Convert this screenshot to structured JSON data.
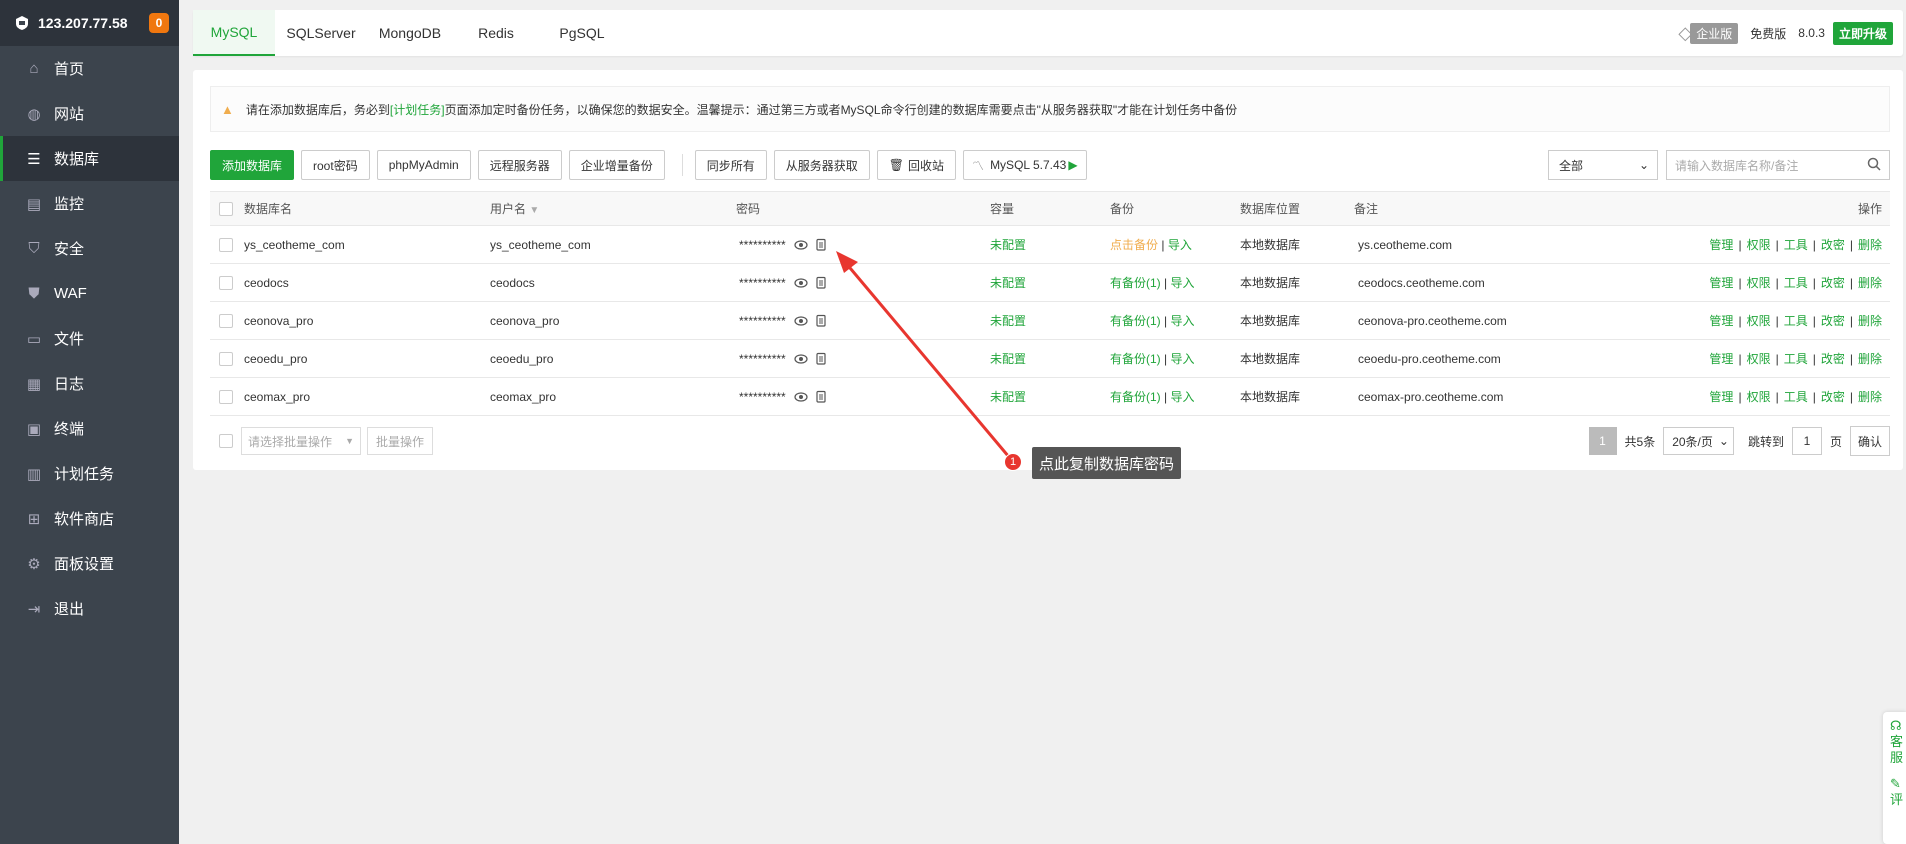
{
  "sidebar": {
    "ip": "123.207.77.58",
    "badge": "0",
    "items": [
      {
        "label": "首页",
        "icon": "home-icon"
      },
      {
        "label": "网站",
        "icon": "globe-icon"
      },
      {
        "label": "数据库",
        "icon": "database-icon"
      },
      {
        "label": "监控",
        "icon": "monitor-icon"
      },
      {
        "label": "安全",
        "icon": "shield-icon"
      },
      {
        "label": "WAF",
        "icon": "waf-shield-icon"
      },
      {
        "label": "文件",
        "icon": "folder-icon"
      },
      {
        "label": "日志",
        "icon": "log-icon"
      },
      {
        "label": "终端",
        "icon": "terminal-icon"
      },
      {
        "label": "计划任务",
        "icon": "calendar-icon"
      },
      {
        "label": "软件商店",
        "icon": "apps-icon"
      },
      {
        "label": "面板设置",
        "icon": "gear-icon"
      },
      {
        "label": "退出",
        "icon": "logout-icon"
      }
    ],
    "active_index": 2
  },
  "tabs": [
    "MySQL",
    "SQLServer",
    "MongoDB",
    "Redis",
    "PgSQL"
  ],
  "active_tab": 0,
  "top_right": {
    "enterprise": "企业版",
    "free": "免费版",
    "version": "8.0.3",
    "upgrade": "立即升级"
  },
  "alert": {
    "prefix": "请在添加数据库后，务必到",
    "link": "[计划任务]",
    "suffix": "页面添加定时备份任务，以确保您的数据安全。温馨提示：通过第三方或者MySQL命令行创建的数据库需要点击\"从服务器获取\"才能在计划任务中备份"
  },
  "toolbar": {
    "add_db": "添加数据库",
    "root_pw": "root密码",
    "phpmyadmin": "phpMyAdmin",
    "remote": "远程服务器",
    "incremental": "企业增量备份",
    "sync_all": "同步所有",
    "fetch": "从服务器获取",
    "recycle": "回收站",
    "mysql_version": "MySQL 5.7.43",
    "filter": "全部",
    "search_placeholder": "请输入数据库名称/备注"
  },
  "table": {
    "headers": {
      "name": "数据库名",
      "user": "用户名",
      "password": "密码",
      "capacity": "容量",
      "backup": "备份",
      "location": "数据库位置",
      "note": "备注",
      "ops": "操作"
    },
    "rows": [
      {
        "name": "ys_ceotheme_com",
        "user": "ys_ceotheme_com",
        "password": "**********",
        "capacity": "未配置",
        "backup": "点击备份",
        "backup_status": "none",
        "import": "导入",
        "location": "本地数据库",
        "note": "ys.ceotheme.com"
      },
      {
        "name": "ceodocs",
        "user": "ceodocs",
        "password": "**********",
        "capacity": "未配置",
        "backup": "有备份(1)",
        "backup_status": "has",
        "import": "导入",
        "location": "本地数据库",
        "note": "ceodocs.ceotheme.com"
      },
      {
        "name": "ceonova_pro",
        "user": "ceonova_pro",
        "password": "**********",
        "capacity": "未配置",
        "backup": "有备份(1)",
        "backup_status": "has",
        "import": "导入",
        "location": "本地数据库",
        "note": "ceonova-pro.ceotheme.com"
      },
      {
        "name": "ceoedu_pro",
        "user": "ceoedu_pro",
        "password": "**********",
        "capacity": "未配置",
        "backup": "有备份(1)",
        "backup_status": "has",
        "import": "导入",
        "location": "本地数据库",
        "note": "ceoedu-pro.ceotheme.com"
      },
      {
        "name": "ceomax_pro",
        "user": "ceomax_pro",
        "password": "**********",
        "capacity": "未配置",
        "backup": "有备份(1)",
        "backup_status": "has",
        "import": "导入",
        "location": "本地数据库",
        "note": "ceomax-pro.ceotheme.com"
      }
    ],
    "ops": [
      "管理",
      "权限",
      "工具",
      "改密",
      "删除"
    ]
  },
  "footer": {
    "batch_placeholder": "请选择批量操作",
    "batch_btn": "批量操作",
    "current_page": "1",
    "total": "共5条",
    "page_size": "20条/页",
    "jump_to": "跳转到",
    "jump_value": "1",
    "page_unit": "页",
    "confirm": "确认"
  },
  "annotation": {
    "number": "1",
    "text": "点此复制数据库密码"
  },
  "float_widget": {
    "service": "客服",
    "review": "评"
  },
  "colors": {
    "accent": "#20a53a",
    "sidebar_bg": "#3c444d",
    "warning": "#f0ad4e",
    "annotation": "#e8362f"
  }
}
